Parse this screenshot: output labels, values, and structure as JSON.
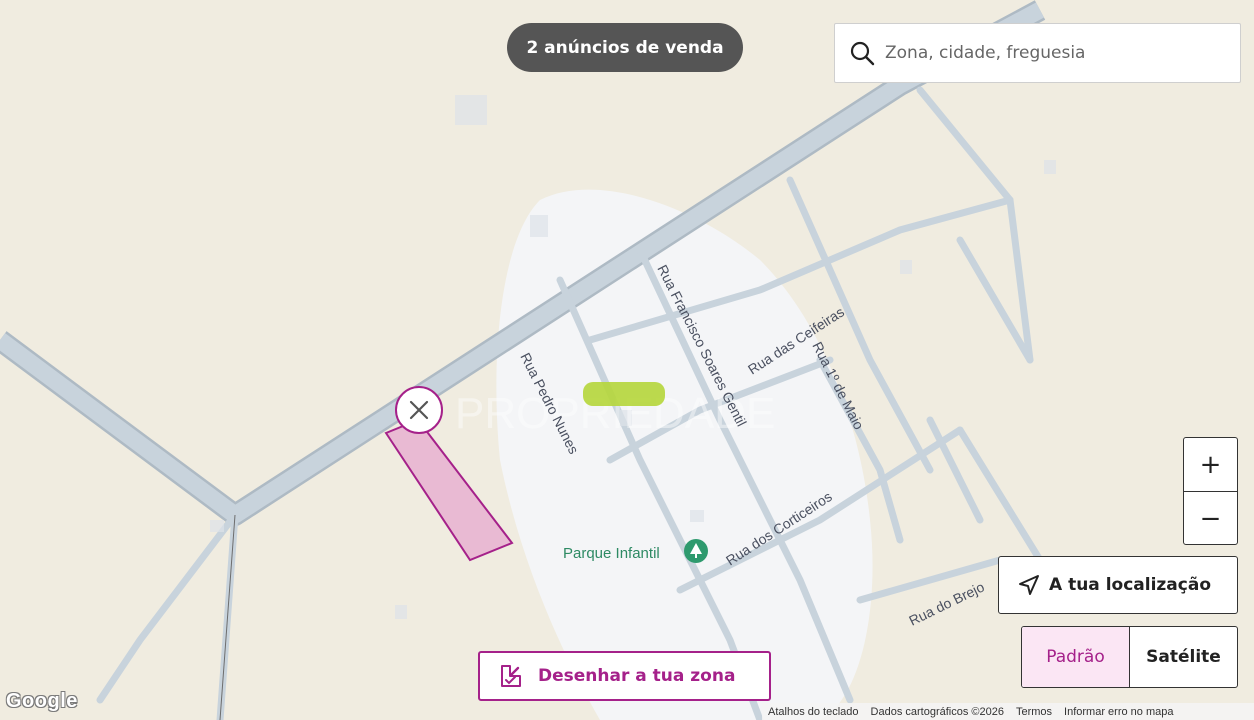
{
  "listings": {
    "count_label": "2 anúncios de venda"
  },
  "search": {
    "placeholder": "Zona, cidade, freguesia",
    "icon": "search-icon"
  },
  "zoom": {
    "in_label": "+",
    "out_label": "−"
  },
  "locate": {
    "label": "A tua localização",
    "icon": "navigation-arrow-icon"
  },
  "map_type": {
    "options": [
      "Padrão",
      "Satélite"
    ],
    "selected": "Padrão"
  },
  "draw_zone": {
    "label": "Desenhar a tua zona",
    "icon": "draw-area-icon"
  },
  "map": {
    "streets": [
      "Rua Francisco Soares Gentil",
      "Rua das Ceifeiras",
      "Rua 1º de Maio",
      "Rua Pedro Nunes",
      "Rua dos Corticeiros",
      "Rua do Brejo"
    ],
    "poi": {
      "label": "Parque Infantil",
      "icon": "tree-pin-icon"
    },
    "watermark": "PROPRIEDADE",
    "colors": {
      "land": "#f0ece0",
      "urban": "#f4f5f7",
      "road": "#c8d3dc",
      "road_edge": "#b0bcc6",
      "parcel": "#a5218a",
      "highlight": "#b5d63a"
    }
  },
  "attribution": {
    "provider": "Google",
    "keyboard": "Atalhos do teclado",
    "data": "Dados cartográficos ©2026",
    "terms": "Termos",
    "report": "Informar erro no mapa"
  },
  "accent_color": "#a5218a"
}
